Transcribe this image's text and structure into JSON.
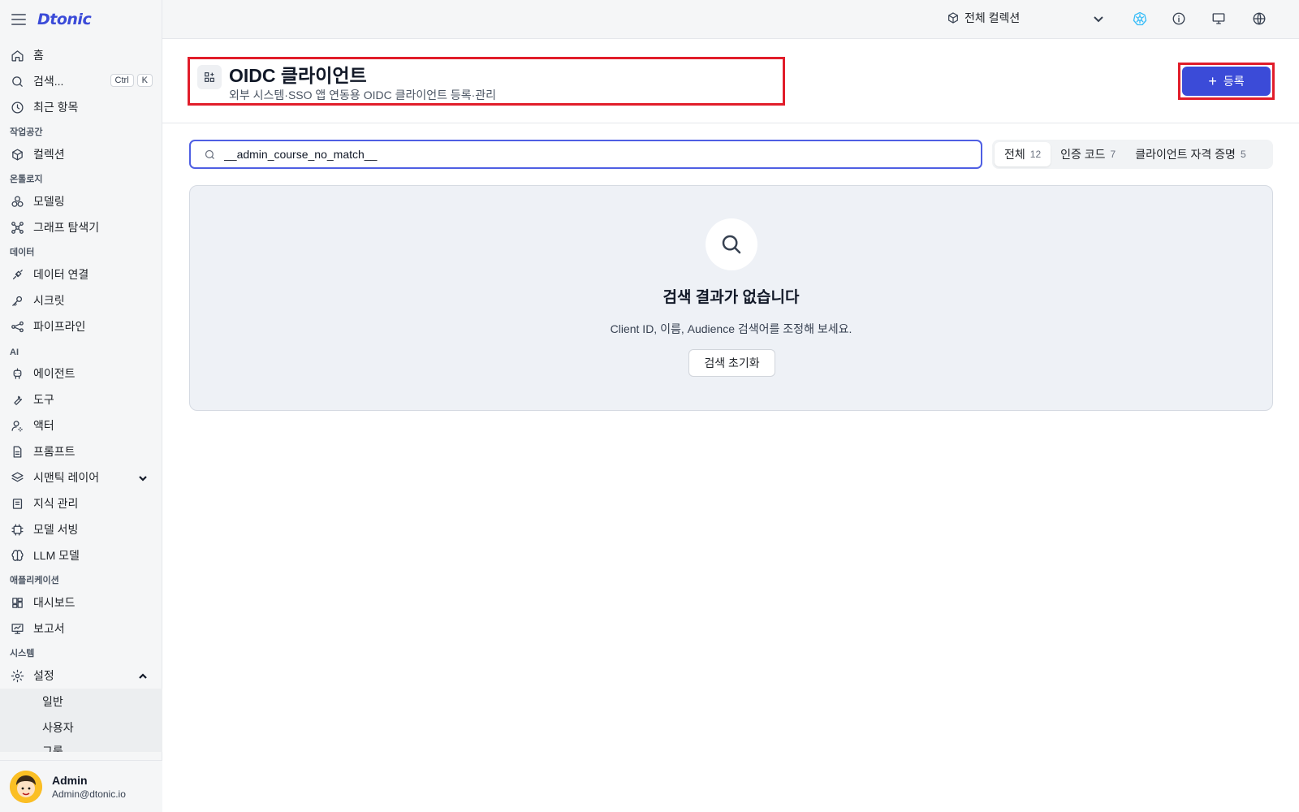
{
  "app": {
    "logo": "Dtonic"
  },
  "topbar": {
    "collection_label": "전체 컬렉션"
  },
  "sidebar": {
    "top_items": [
      {
        "label": "홈",
        "icon": "home-icon"
      },
      {
        "label": "검색...",
        "icon": "search-icon",
        "shortcut": [
          "Ctrl",
          "K"
        ]
      },
      {
        "label": "최근 항목",
        "icon": "clock-icon"
      }
    ],
    "sections": {
      "workspace": "작업공간",
      "ontology": "온톨로지",
      "data": "데이터",
      "ai": "AI",
      "apps": "애플리케이션",
      "system": "시스템"
    },
    "items": {
      "collection": "컬렉션",
      "modeling": "모델링",
      "graph_explorer": "그래프 탐색기",
      "data_connection": "데이터 연결",
      "secret": "시크릿",
      "pipeline": "파이프라인",
      "agent": "에이전트",
      "tool": "도구",
      "actor": "액터",
      "prompt": "프롬프트",
      "semantic_layer": "시맨틱 레이어",
      "knowledge": "지식 관리",
      "model_serving": "모델 서빙",
      "llm_model": "LLM 모델",
      "dashboard": "대시보드",
      "report": "보고서",
      "settings": "설정"
    },
    "settings_sub": [
      "일반",
      "사용자",
      "그룹"
    ],
    "user": {
      "name": "Admin",
      "email": "Admin@dtonic.io"
    }
  },
  "page": {
    "title": "OIDC 클라이언트",
    "subtitle": "외부 시스템·SSO 앱 연동용 OIDC 클라이언트 등록·관리",
    "register_label": "등록"
  },
  "search": {
    "value": "__admin_course_no_match__"
  },
  "tabs": [
    {
      "label": "전체",
      "count": "12"
    },
    {
      "label": "인증 코드",
      "count": "7"
    },
    {
      "label": "클라이언트 자격 증명",
      "count": "5"
    }
  ],
  "empty_state": {
    "title": "검색 결과가 없습니다",
    "description": "Client ID, 이름, Audience 검색어를 조정해 보세요.",
    "reset_label": "검색 초기화"
  },
  "colors": {
    "accent": "#3b4bd8",
    "highlight": "#e11d2a"
  }
}
